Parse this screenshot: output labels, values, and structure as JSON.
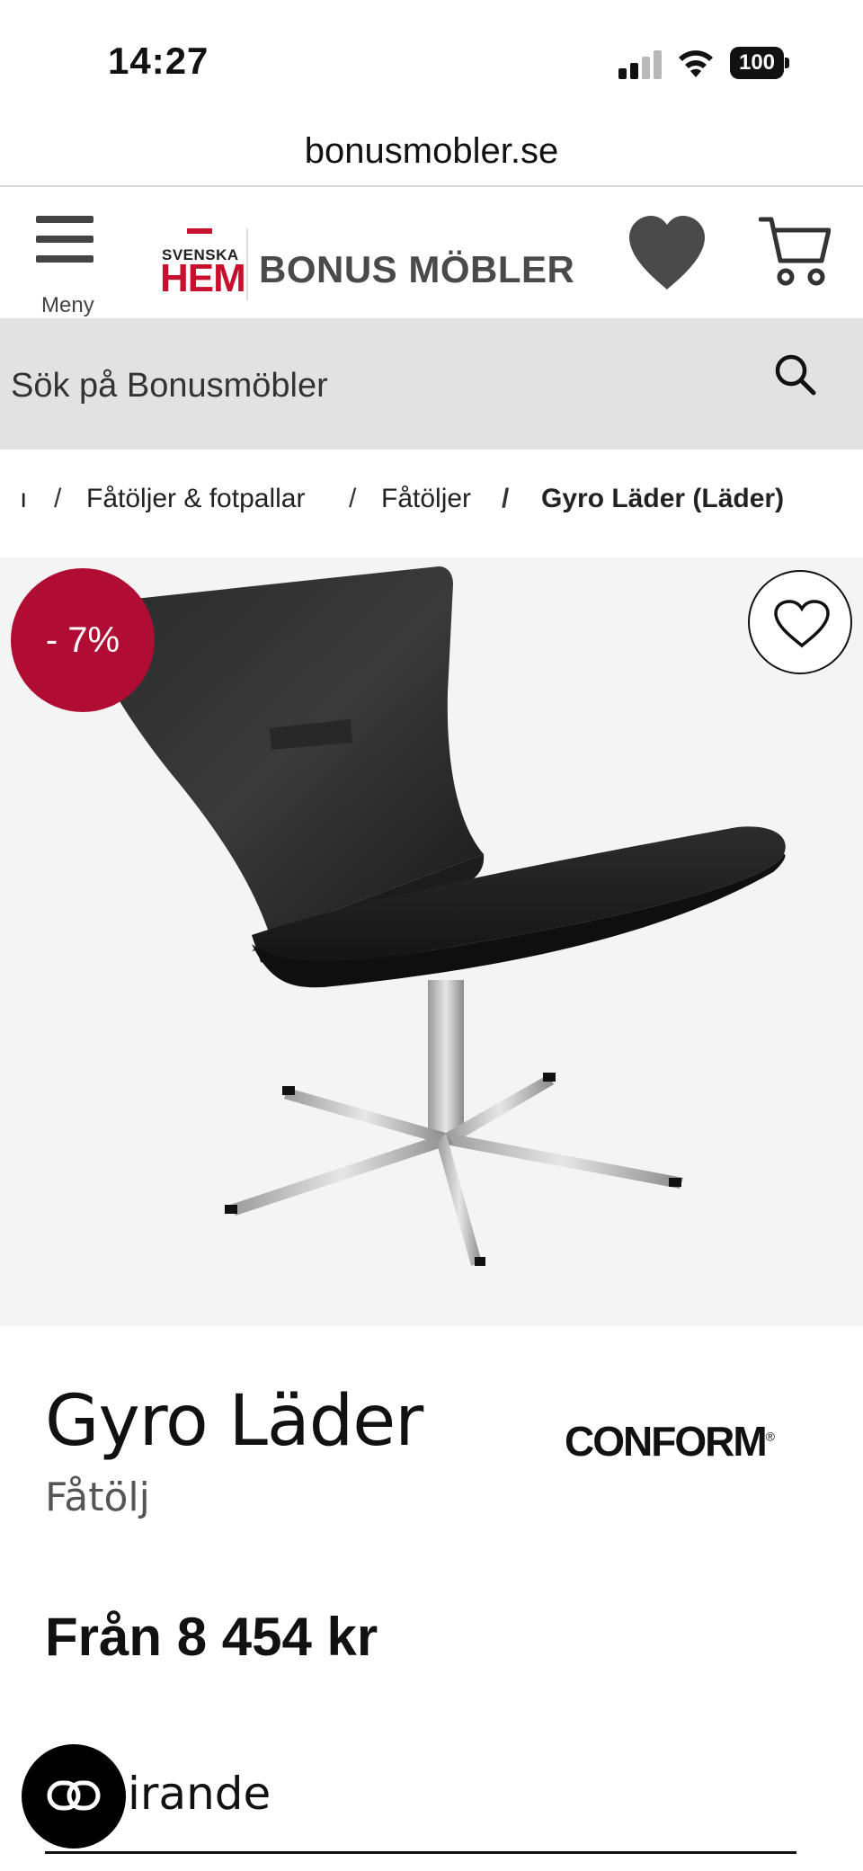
{
  "status_bar": {
    "time": "14:27",
    "battery": "100"
  },
  "browser": {
    "url": "bonusmobler.se"
  },
  "header": {
    "menu_label": "Meny",
    "logo_svenska": "SVENSKA",
    "logo_hem": "HEM",
    "logo_brand": "BONUS MÖBLER"
  },
  "search": {
    "placeholder": "Sök på Bonusmöbler"
  },
  "breadcrumb": {
    "items": [
      "ı",
      "Fåtöljer & fotpallar",
      "Fåtöljer",
      "Gyro Läder (Läder)"
    ],
    "separator": "/"
  },
  "product": {
    "discount": "- 7%",
    "title": "Gyro Läder",
    "type": "Fåtölj",
    "brand": "CONFORM",
    "brand_mark": "®",
    "price": "Från 8 454 kr",
    "section_label": "irande"
  },
  "colors": {
    "accent_red": "#c8102e",
    "discount_red": "#b10d34",
    "search_bg": "#e2e2e2"
  },
  "icons": {
    "menu": "hamburger-icon",
    "wishlist": "heart-icon",
    "cart": "cart-icon",
    "search": "search-icon",
    "favorite": "heart-outline-icon",
    "chat": "chat-icon"
  }
}
